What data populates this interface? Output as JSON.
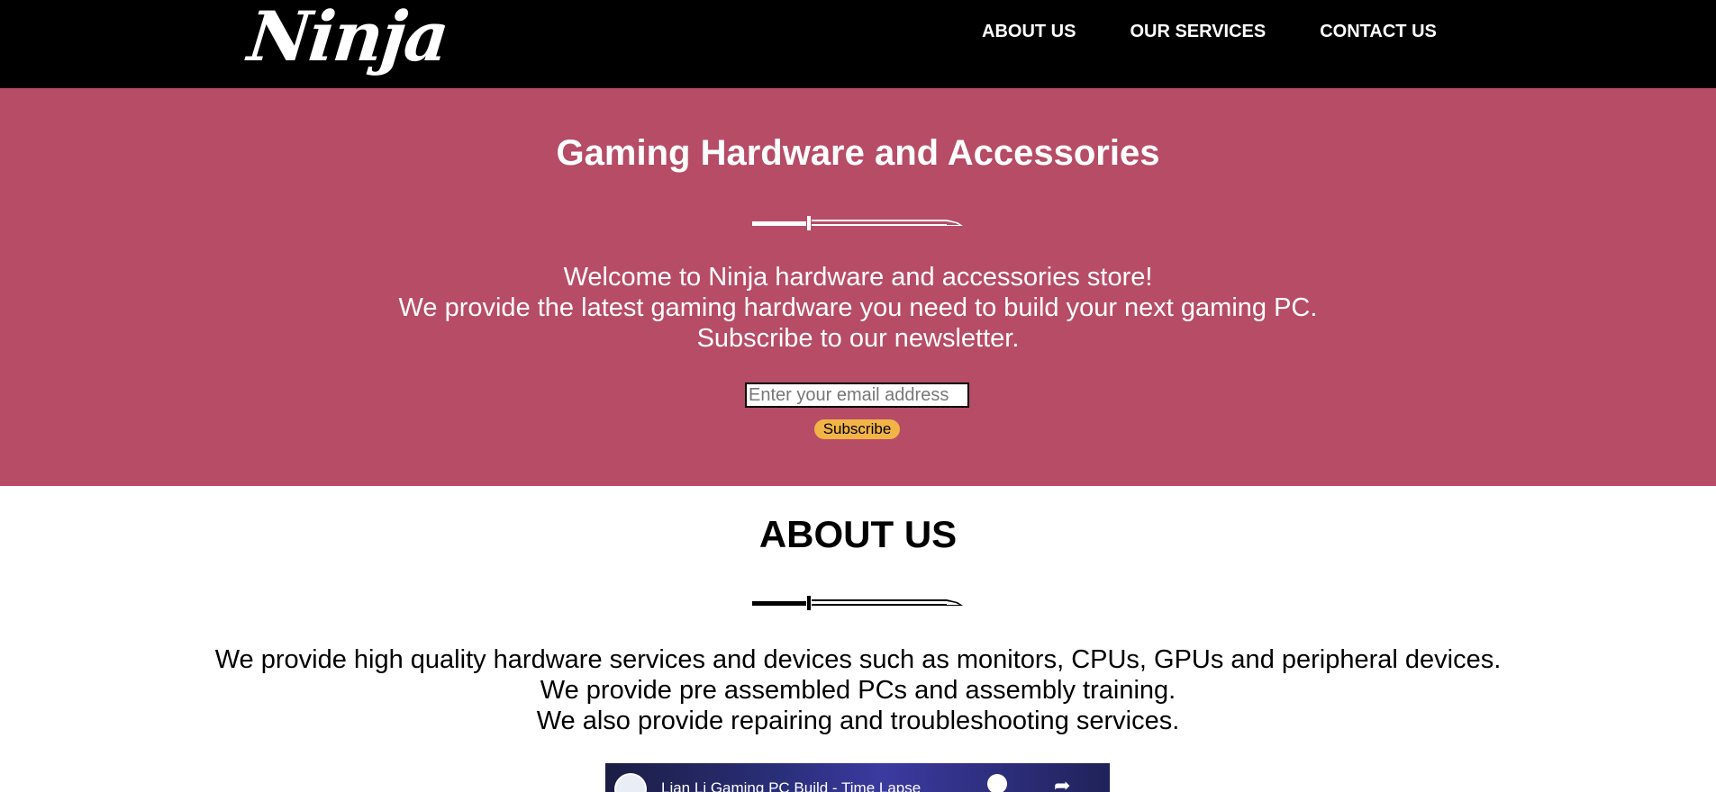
{
  "header": {
    "logo": "Ninja",
    "nav": [
      {
        "label": "ABOUT US"
      },
      {
        "label": "OUR SERVICES"
      },
      {
        "label": "CONTACT US"
      }
    ]
  },
  "hero": {
    "title": "Gaming Hardware and Accessories",
    "lines": [
      "Welcome to Ninja hardware and accessories store!",
      "We provide the latest gaming hardware you need to build your next gaming PC.",
      "Subscribe to our newsletter."
    ],
    "email_placeholder": "Enter your email address",
    "subscribe_label": "Subscribe"
  },
  "about": {
    "title": "ABOUT US",
    "lines": [
      "We provide high quality hardware services and devices such as monitors, CPUs, GPUs and peripheral devices.",
      "We provide pre assembled PCs and assembly training.",
      "We also provide repairing and troubleshooting services."
    ]
  },
  "video": {
    "title": "Lian Li Gaming PC Build - Time Lapse"
  },
  "colors": {
    "header_bg": "#000000",
    "hero_bg": "#b74c66",
    "button_bg": "#f2b447"
  }
}
